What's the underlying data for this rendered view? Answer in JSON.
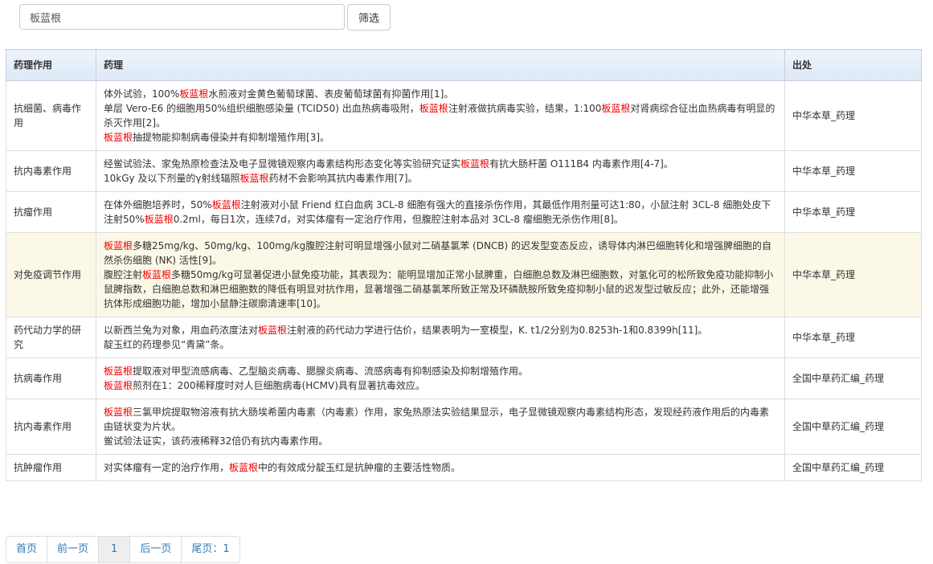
{
  "search": {
    "value": "板蓝根",
    "button_label": "筛选"
  },
  "keyword": "板蓝根",
  "colors": {
    "keyword": "#ee0000",
    "highlight_row": "#fcf8e8",
    "link": "#337ab7"
  },
  "table": {
    "headers": [
      "药理作用",
      "药理",
      "出处"
    ],
    "rows": [
      {
        "effect": "抗细菌、病毒作用",
        "source": "中华本草_药理",
        "lines": [
          "体外试验，100%板蓝根水煎液对金黄色葡萄球菌、表皮葡萄球菌有抑菌作用[1]。",
          "单层 Vero-E6 的细胞用50%组织细胞感染量 (TCID50) 出血热病毒吸附，板蓝根注射液做抗病毒实验，结果，1:100板蓝根对肾病综合征出血热病毒有明显的杀灭作用[2]。",
          "板蓝根抽提物能抑制病毒侵染并有抑制增殖作用[3]。"
        ]
      },
      {
        "effect": "抗内毒素作用",
        "source": "中华本草_药理",
        "lines": [
          "经鲎试验法、家兔热原检查法及电子显微镜观察内毒素结构形态变化等实验研究证实板蓝根有抗大肠杆菌 O111B4 内毒素作用[4-7]。",
          "10kGy 及以下剂量的γ射线辐照板蓝根药材不会影响其抗内毒素作用[7]。"
        ]
      },
      {
        "effect": "抗瘤作用",
        "source": "中华本草_药理",
        "lines": [
          "在体外细胞培养时，50%板蓝根注射液对小鼠 Friend 红白血病 3CL-8 细胞有强大的直接杀伤作用，其最低作用剂量可达1:80，小鼠注射 3CL-8 细胞处皮下注射50%板蓝根0.2ml，每日1次，连续7d，对实体瘤有一定治疗作用，但腹腔注射本品对 3CL-8 瘤细胞无杀伤作用[8]。"
        ]
      },
      {
        "effect": "对免疫调节作用",
        "source": "中华本草_药理",
        "highlighted": true,
        "lines": [
          "板蓝根多糖25mg/kg、50mg/kg、100mg/kg腹腔注射可明显增强小鼠对二硝基氯苯 (DNCB) 的迟发型变态反应，诱导体内淋巴细胞转化和增强脾细胞的自然杀伤细胞 (NK) 活性[9]。",
          "腹腔注射板蓝根多糖50mg/kg可显著促进小鼠免疫功能，其表现为：能明显增加正常小鼠脾重，白细胞总数及淋巴细胞数，对氢化可的松所致免疫功能抑制小鼠脾指数，白细胞总数和淋巴细胞数的降低有明显对抗作用，显著增强二硝基氯苯所致正常及环磷酰胺所致免疫抑制小鼠的迟发型过敏反应；此外，还能增强抗体形成细胞功能，增加小鼠静注碳廓清速率[10]。"
        ]
      },
      {
        "effect": "药代动力学的研究",
        "source": "中华本草_药理",
        "lines": [
          "以新西兰兔为对象，用血药浓度法对板蓝根注射液的药代动力学进行估价，结果表明为一室模型，K. t1/2分别为0.8253h-1和0.8399h[11]。",
          "靛玉红的药理参见“青黛”条。"
        ]
      },
      {
        "effect": "抗病毒作用",
        "source": "全国中草药汇编_药理",
        "lines": [
          "板蓝根提取液对甲型流感病毒、乙型脑炎病毒、腮腺炎病毒、流感病毒有抑制感染及抑制增殖作用。",
          "板蓝根煎剂在1：200稀释度时对人巨细胞病毒(HCMV)具有显著抗毒效应。"
        ]
      },
      {
        "effect": "抗内毒素作用",
        "source": "全国中草药汇编_药理",
        "lines": [
          "板蓝根三氯甲烷提取物溶液有抗大肠埃希菌内毒素（内毒素）作用，家兔热原法实验结果显示，电子显微镜观察内毒素结构形态，发现经药液作用后的内毒素由链状变为片状。",
          "鲎试验法证实，该药液稀释32倍仍有抗内毒素作用。"
        ]
      },
      {
        "effect": "抗肿瘤作用",
        "source": "全国中草药汇编_药理",
        "lines": [
          "对实体瘤有一定的治疗作用，板蓝根中的有效成分靛玉红是抗肿瘤的主要活性物质。"
        ]
      }
    ]
  },
  "pagination": {
    "first": "首页",
    "prev": "前一页",
    "current": "1",
    "next": "后一页",
    "last": "尾页：1"
  }
}
